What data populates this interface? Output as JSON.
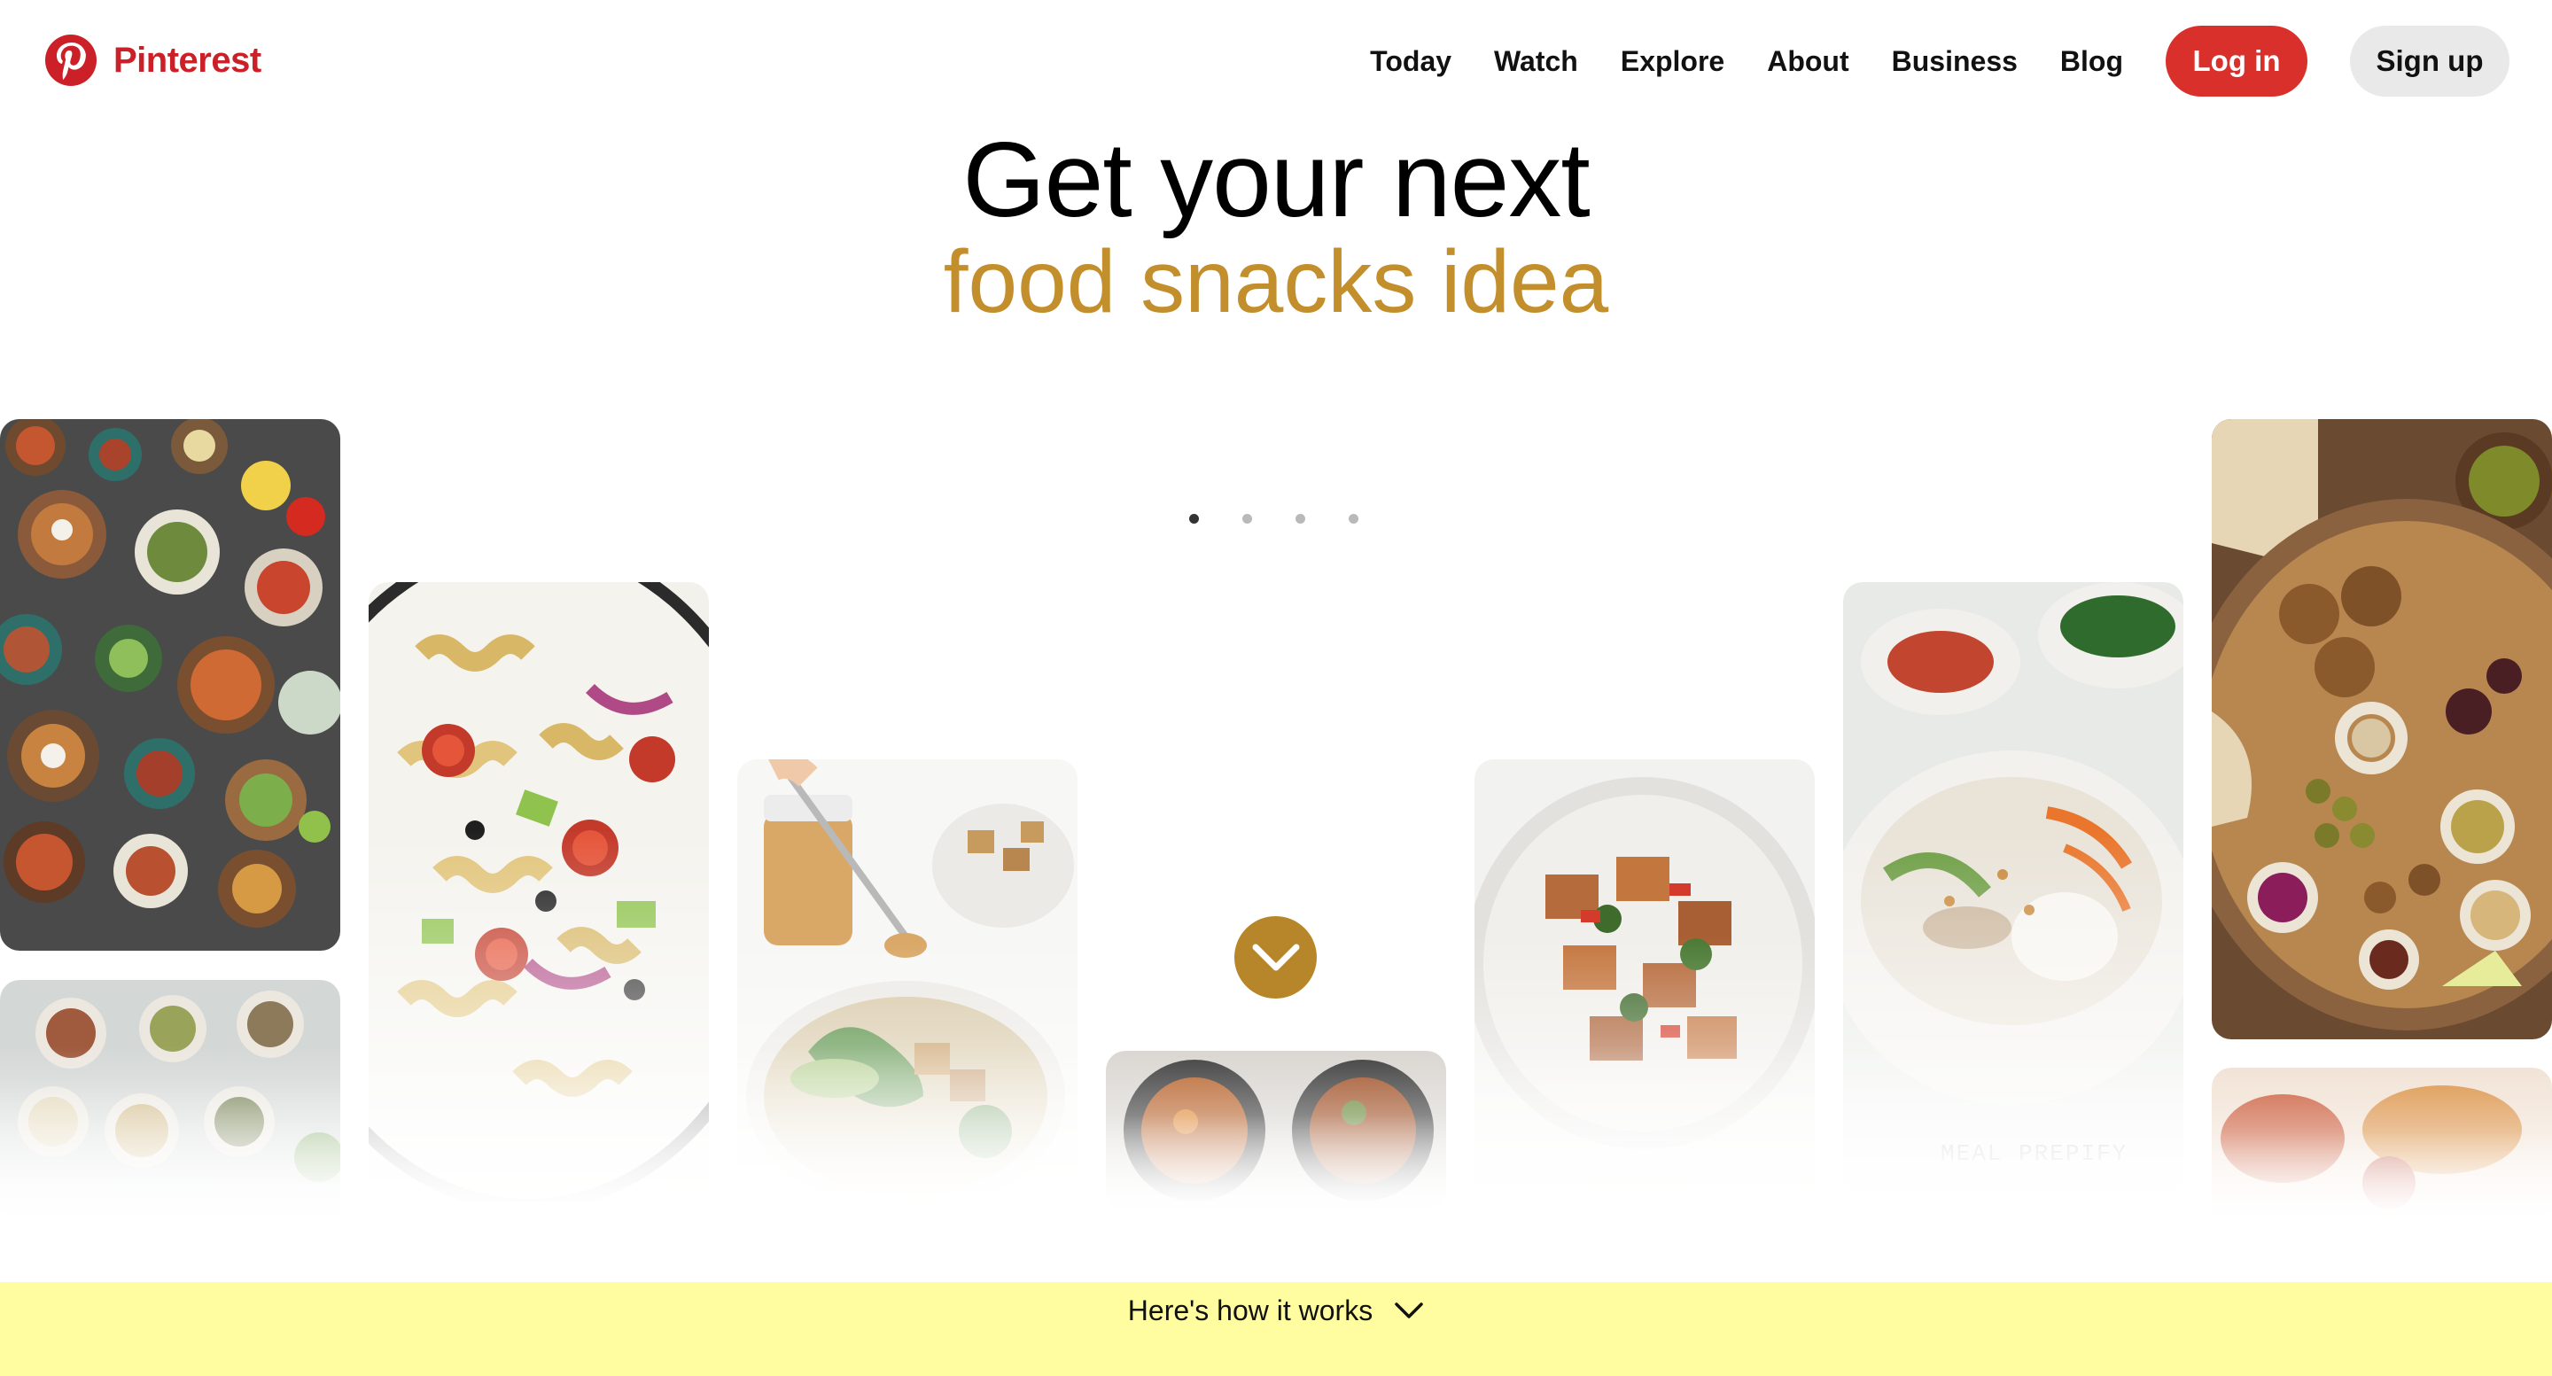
{
  "brand": {
    "name": "Pinterest",
    "color": "#cb2027",
    "logo_icon": "pinterest-logo-icon"
  },
  "nav": {
    "links": [
      "Today",
      "Watch",
      "Explore",
      "About",
      "Business",
      "Blog"
    ],
    "login_label": "Log in",
    "signup_label": "Sign up"
  },
  "hero": {
    "line1": "Get your next",
    "line2": "food snacks idea",
    "line2_color": "#c28f2c"
  },
  "carousel": {
    "dot_count": 4,
    "active_index": 0
  },
  "tiles": [
    {
      "subject": "bowls of assorted dishes"
    },
    {
      "subject": "bowls of grains and beans"
    },
    {
      "subject": "pasta salad"
    },
    {
      "subject": "peanut sauce bowl"
    },
    {
      "subject": "curry bowls"
    },
    {
      "subject": "tofu stir fry"
    },
    {
      "subject": "noodle salad bowl"
    },
    {
      "subject": "falafel platter"
    }
  ],
  "tile_caption": "MEAL PREPIFY",
  "down_button_icon": "chevron-down-icon",
  "footer_bar": {
    "label": "Here's how it works",
    "color": "#fffd9f",
    "icon": "chevron-down-icon"
  }
}
